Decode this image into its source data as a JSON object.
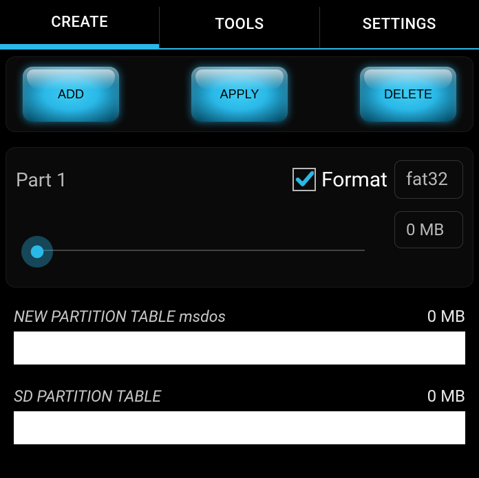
{
  "tabs": {
    "create": "CREATE",
    "tools": "TOOLS",
    "settings": "SETTINGS"
  },
  "actions": {
    "add": "ADD",
    "apply": "APPLY",
    "delete": "DELETE"
  },
  "partition": {
    "label": "Part 1",
    "format_label": "Format",
    "format_checked": true,
    "filesystem": "fat32",
    "size": "0 MB"
  },
  "tables": [
    {
      "title": "NEW PARTITION TABLE msdos",
      "size": "0 MB"
    },
    {
      "title": "SD PARTITION TABLE",
      "size": "0 MB"
    }
  ]
}
